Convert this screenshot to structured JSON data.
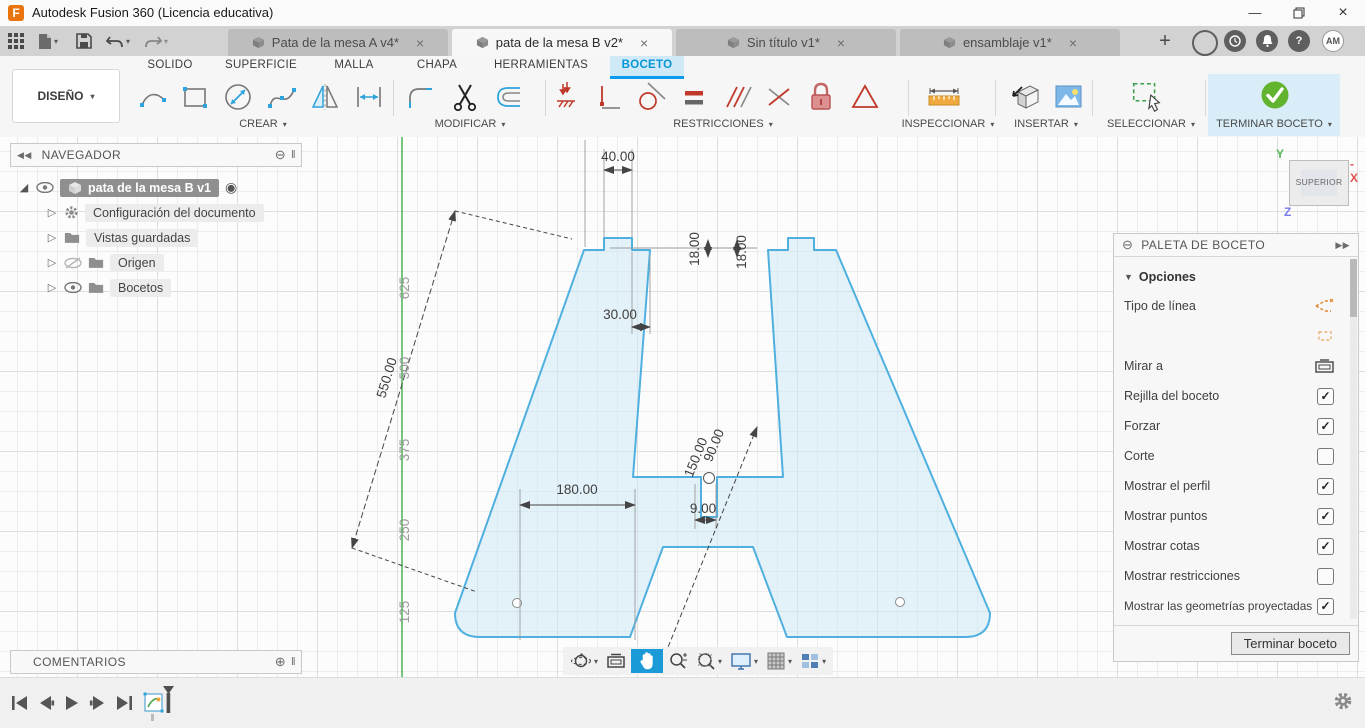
{
  "colors": {
    "accent_blue": "#0696d7",
    "sketch_line": "#4fb0e0",
    "axis_green": "#3fae49",
    "constraint_red": "#c0392b",
    "finish_green": "#62b32e",
    "highlight_blue": "#d8edf8"
  },
  "chrome": {
    "caret": "▾",
    "close_glyph": "×",
    "minimize_glyph": "—",
    "collapse_left": "◀◀",
    "collapse_right": "▶▶",
    "circle_minus": "⊖",
    "circle_plus": "⊕",
    "grip": "‖",
    "expander": "▷",
    "root_expander": "◢",
    "radio_target": "◉",
    "new_tab": "+",
    "help_glyph": "?"
  },
  "title_bar": {
    "app_title": "Autodesk Fusion 360 (Licencia educativa)",
    "logo_letter": "F"
  },
  "document_tabs": [
    {
      "label": "Pata de la mesa A v4*"
    },
    {
      "label": "pata de la mesa B v2*"
    },
    {
      "label": "Sin título v1*"
    },
    {
      "label": "ensamblaje v1*"
    }
  ],
  "account": {
    "initials": "AM"
  },
  "ribbon": {
    "design_button": "DISEÑO",
    "tabs": [
      {
        "label": "SOLIDO"
      },
      {
        "label": "SUPERFICIE"
      },
      {
        "label": "MALLA"
      },
      {
        "label": "CHAPA"
      },
      {
        "label": "HERRAMIENTAS"
      },
      {
        "label": "BOCETO"
      }
    ],
    "active_tab": "BOCETO",
    "groups": {
      "create": "CREAR",
      "modify": "MODIFICAR",
      "constraints": "RESTRICCIONES",
      "inspect": "INSPECCIONAR",
      "insert": "INSERTAR",
      "select": "SELECCIONAR",
      "finish": "TERMINAR BOCETO"
    }
  },
  "navigator": {
    "title": "NAVEGADOR",
    "document_name": "pata de la mesa B v1",
    "items": [
      {
        "label": "Configuración del documento"
      },
      {
        "label": "Vistas guardadas"
      },
      {
        "label": "Origen"
      },
      {
        "label": "Bocetos"
      }
    ]
  },
  "sketch_palette": {
    "title": "PALETA DE BOCETO",
    "section": "Opciones",
    "rows": [
      {
        "label": "Tipo de línea",
        "check": null
      },
      {
        "label": "",
        "check": null
      },
      {
        "label": "Mirar a",
        "check": null
      },
      {
        "label": "Rejilla del boceto",
        "check": "✓"
      },
      {
        "label": "Forzar",
        "check": "✓"
      },
      {
        "label": "Corte",
        "check": ""
      },
      {
        "label": "Mostrar el perfil",
        "check": "✓"
      },
      {
        "label": "Mostrar puntos",
        "check": "✓"
      },
      {
        "label": "Mostrar cotas",
        "check": "✓"
      },
      {
        "label": "Mostrar restricciones",
        "check": ""
      },
      {
        "label": "Mostrar las geometrías proyectadas",
        "check": "✓"
      }
    ],
    "finish_button": "Terminar boceto"
  },
  "comments_panel": {
    "title": "COMENTARIOS"
  },
  "viewcube": {
    "face": "SUPERIOR",
    "axis_y": "Y",
    "axis_x": "-X",
    "axis_z": "Z"
  },
  "canvas_dimensions": {
    "top_width": "40.00",
    "tab_height_left": "18.00",
    "tab_height_right": "18.00",
    "leg_offset": "30.00",
    "diagonal_length": "550.00",
    "inner_width": "180.00",
    "slot_diagonal": "150.00",
    "crossbar_dim": "90.00",
    "slot_width": "9.00"
  },
  "axis_ruler_labels": [
    "625",
    "500",
    "375",
    "250",
    "125"
  ]
}
